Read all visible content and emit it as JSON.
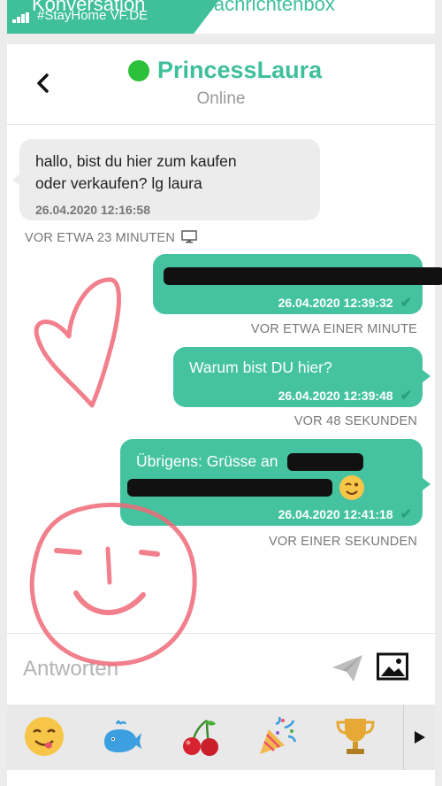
{
  "topbar": {
    "carrier": "#StayHome VF.DE",
    "tab_conversation": "Konversation",
    "tab_inbox": "Nachrichtenbox"
  },
  "header": {
    "contact_name": "PrincessLaura",
    "status": "Online"
  },
  "messages": [
    {
      "direction": "incoming",
      "line1": "hallo, bist du hier zum kaufen",
      "line2": "oder verkaufen? lg laura",
      "timestamp": "26.04.2020 12:16:58",
      "ago": "VOR ETWA 23 MINUTEN",
      "device_icon": "monitor-icon"
    },
    {
      "direction": "outgoing",
      "text_redacted": "[redacted]",
      "timestamp": "26.04.2020 12:39:32",
      "ago": "VOR ETWA EINER MINUTE"
    },
    {
      "direction": "outgoing",
      "line1": "Warum bist DU hier?",
      "timestamp": "26.04.2020 12:39:48",
      "ago": "VOR 48 SEKUNDEN"
    },
    {
      "direction": "outgoing",
      "line1": "Übrigens: Grüsse an",
      "timestamp": "26.04.2020 12:41:18",
      "ago": "VOR EINER SEKUNDEN"
    }
  ],
  "composer": {
    "placeholder": "Antworten"
  },
  "emoji_bar": {
    "items": [
      "yum-face-icon",
      "whale-icon",
      "cherries-icon",
      "party-popper-icon",
      "trophy-icon"
    ],
    "more_icon": "play-arrow-icon"
  },
  "colors": {
    "accent": "#3fbf9a",
    "bubble_out": "#45c3a0",
    "bubble_in": "#ececec",
    "online": "#2cc13a",
    "doodle": "#f06a78"
  }
}
